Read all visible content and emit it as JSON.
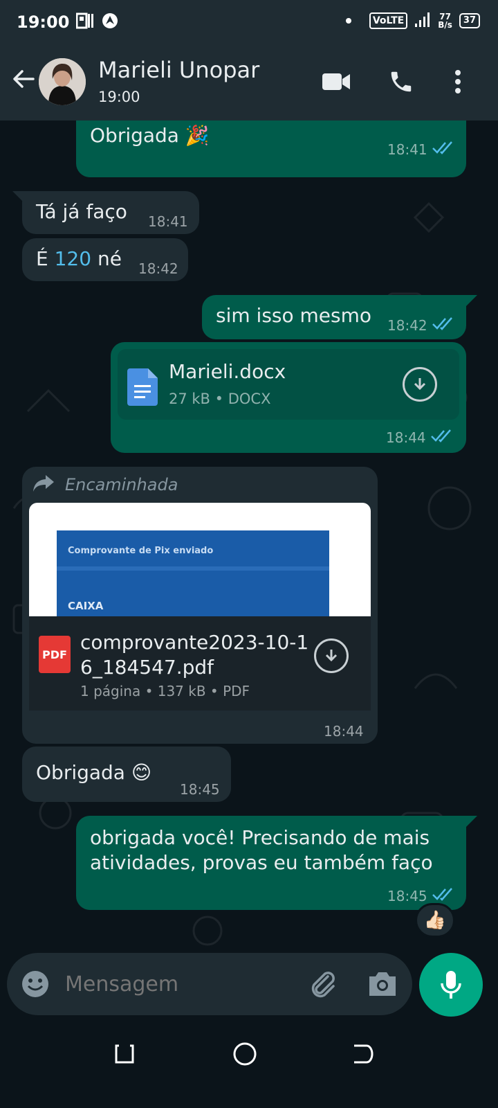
{
  "status_bar": {
    "time": "19:00",
    "network": "VoLTE",
    "speed_value": "77",
    "speed_unit": "B/s",
    "battery": "37"
  },
  "header": {
    "contact_name": "Marieli Unopar",
    "subtitle": "19:00"
  },
  "messages": [
    {
      "text": "Obrigada 🎉",
      "time": "18:41"
    },
    {
      "text": "Tá já faço",
      "time": "18:41"
    },
    {
      "text_before": "É ",
      "link": "120",
      "text_after": " né",
      "time": "18:42"
    },
    {
      "text": "sim isso mesmo",
      "time": "18:42"
    },
    {
      "file_name": "Marieli.docx",
      "file_meta": "27 kB • DOCX",
      "time": "18:44"
    },
    {
      "forwarded_label": "Encaminhada",
      "thumb_title": "Comprovante de Pix enviado",
      "thumb_brand": "CAIXA",
      "pdf_icon_label": "PDF",
      "file_name_line1": "comprovante2023-10-1",
      "file_name_line2": "6_184547.pdf",
      "file_meta": "1 página • 137 kB • PDF",
      "time": "18:44"
    },
    {
      "text": "Obrigada 😊",
      "time": "18:45"
    },
    {
      "text_line1": "obrigada você! Precisando de mais",
      "text_line2": "atividades, provas eu também faço",
      "time": "18:45",
      "reaction": "👍🏻"
    }
  ],
  "input": {
    "placeholder": "Mensagem"
  },
  "colors": {
    "outgoing_bubble": "#005c4b",
    "incoming_bubble": "#1f2c33",
    "accent": "#00a884",
    "read_ticks": "#53bdeb"
  }
}
